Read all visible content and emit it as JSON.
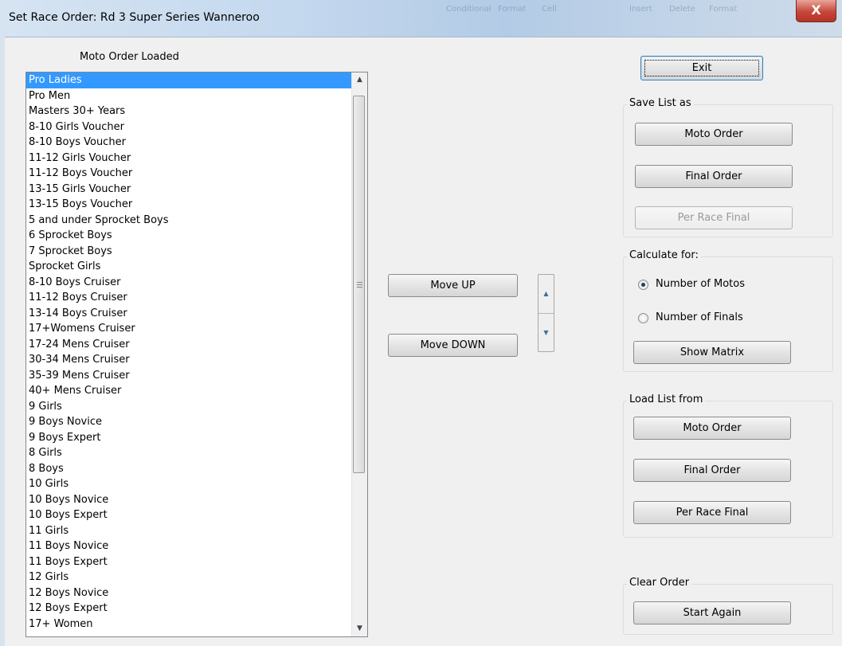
{
  "window": {
    "title": "Set Race Order: Rd 3 Super Series Wanneroo",
    "close_glyph": "X",
    "background_ribbon": [
      "Conditional",
      "Format",
      "Cell",
      "Insert",
      "Delete",
      "Format"
    ]
  },
  "list_panel": {
    "header": "Moto Order Loaded",
    "selected_index": 0,
    "items": [
      "Pro Ladies",
      "Pro Men",
      "Masters 30+ Years",
      "8-10 Girls Voucher",
      "8-10 Boys Voucher",
      "11-12 Girls Voucher",
      "11-12 Boys Voucher",
      "13-15 Girls Voucher",
      "13-15 Boys Voucher",
      "5 and under Sprocket Boys",
      "6 Sprocket Boys",
      "7 Sprocket Boys",
      "Sprocket Girls",
      "8-10 Boys Cruiser",
      "11-12 Boys Cruiser",
      "13-14 Boys Cruiser",
      "17+Womens Cruiser",
      "17-24 Mens Cruiser",
      "30-34 Mens Cruiser",
      "35-39 Mens Cruiser",
      "40+ Mens Cruiser",
      "9 Girls",
      "9 Boys Novice",
      "9 Boys Expert",
      "8 Girls",
      "8 Boys",
      "10 Girls",
      "10 Boys Novice",
      "10 Boys Expert",
      "11 Girls",
      "11 Boys Novice",
      "11 Boys Expert",
      "12 Girls",
      "12 Boys Novice",
      "12 Boys Expert",
      "17+ Women"
    ]
  },
  "move_controls": {
    "up_label": "Move UP",
    "down_label": "Move DOWN",
    "spin_up_icon": "arrow-up-icon",
    "spin_down_icon": "arrow-down-icon"
  },
  "exit_label": "Exit",
  "save_group": {
    "title": "Save List as",
    "moto_order": "Moto Order",
    "final_order": "Final Order",
    "per_race_final": "Per Race Final",
    "per_race_final_enabled": false
  },
  "calc_group": {
    "title": "Calculate for:",
    "option_motos": "Number of Motos",
    "option_finals": "Number of Finals",
    "selected": "Number of Motos",
    "show_matrix": "Show Matrix"
  },
  "load_group": {
    "title": "Load List from",
    "moto_order": "Moto Order",
    "final_order": "Final Order",
    "per_race_final": "Per Race Final"
  },
  "clear_group": {
    "title": "Clear Order",
    "start_again": "Start Again"
  }
}
